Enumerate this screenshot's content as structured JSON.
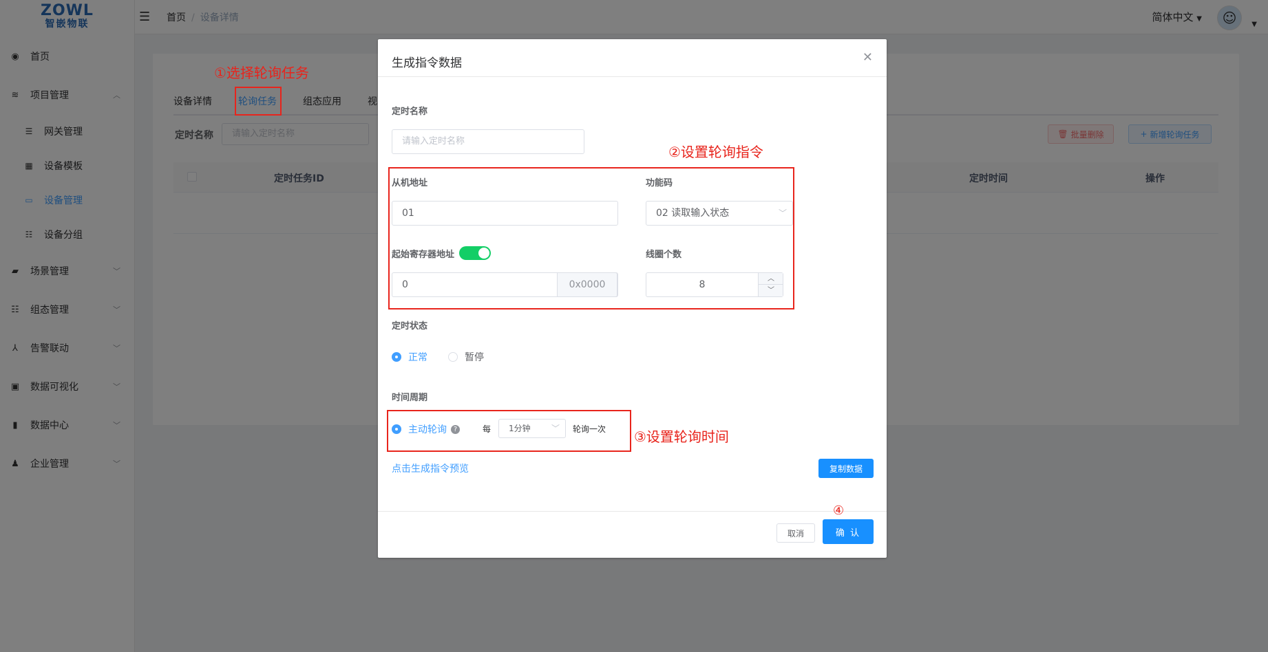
{
  "logo": {
    "brand": "ZOWL",
    "sub": "智嵌物联"
  },
  "sidebar": {
    "items": [
      {
        "label": "首页",
        "icon": "dashboard-icon",
        "glyph": "◉"
      },
      {
        "label": "项目管理",
        "icon": "layers-icon",
        "glyph": "≋",
        "expanded": true,
        "children": [
          {
            "label": "网关管理",
            "icon": "list-icon",
            "glyph": "☰"
          },
          {
            "label": "设备模板",
            "icon": "grid-icon",
            "glyph": "▦"
          },
          {
            "label": "设备管理",
            "icon": "server-icon",
            "glyph": "▭",
            "active": true
          },
          {
            "label": "设备分组",
            "icon": "group-icon",
            "glyph": "☷"
          }
        ]
      },
      {
        "label": "场景管理",
        "icon": "clapper-icon",
        "glyph": "▰"
      },
      {
        "label": "组态管理",
        "icon": "config-icon",
        "glyph": "☷"
      },
      {
        "label": "告警联动",
        "icon": "network-icon",
        "glyph": "⅄"
      },
      {
        "label": "数据可视化",
        "icon": "monitor-icon",
        "glyph": "▣"
      },
      {
        "label": "数据中心",
        "icon": "bar-chart-icon",
        "glyph": "▮"
      },
      {
        "label": "企业管理",
        "icon": "users-icon",
        "glyph": "♟"
      }
    ]
  },
  "header": {
    "breadcrumb": [
      "首页",
      "设备详情"
    ],
    "language": "简体中文"
  },
  "page": {
    "tabs": [
      "设备详情",
      "轮询任务",
      "组态应用",
      "视"
    ],
    "active_tab": 1,
    "filter_label": "定时名称",
    "filter_placeholder": "请输入定时名称",
    "batch_delete": "批量删除",
    "add_task": "新增轮询任务",
    "columns": [
      "定时任务ID",
      "定时时间",
      "操作"
    ]
  },
  "dialog": {
    "title": "生成指令数据",
    "timer_name_label": "定时名称",
    "timer_name_placeholder": "请输入定时名称",
    "slave_addr_label": "从机地址",
    "slave_addr_value": "01",
    "func_code_label": "功能码",
    "func_code_value": "02 读取输入状态",
    "start_reg_label": "起始寄存器地址",
    "start_reg_value": "0",
    "start_reg_hex": "0x0000",
    "coil_count_label": "线圈个数",
    "coil_count_value": "8",
    "status_label": "定时状态",
    "status_options": [
      "正常",
      "暂停"
    ],
    "status_selected": 0,
    "period_label": "时间周期",
    "active_poll_label": "主动轮询",
    "every_label": "每",
    "interval_value": "1分钟",
    "poll_once_label": "轮询一次",
    "preview_link": "点击生成指令预览",
    "copy_button": "复制数据",
    "cancel_button": "取消",
    "confirm_button": "确 认"
  },
  "annotations": {
    "step1": "①选择轮询任务",
    "step2": "②设置轮询指令",
    "step3": "③设置轮询时间",
    "step4": "④",
    "color": "#e8241c"
  },
  "colors": {
    "primary": "#409eff",
    "switch_on": "#13ce66",
    "annotation": "#e8241c"
  }
}
